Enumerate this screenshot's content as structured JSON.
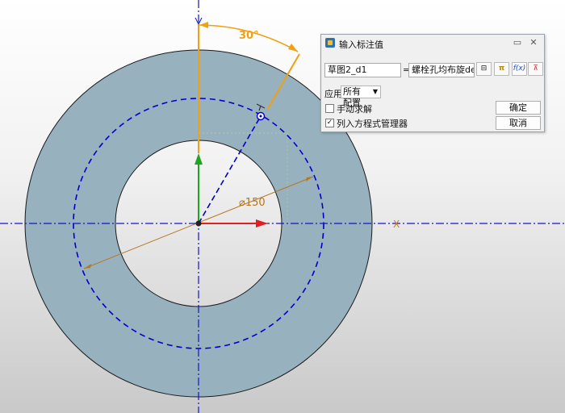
{
  "sketch": {
    "angle_dim_text": "30°",
    "diameter_dim_text": "⌀150",
    "x_axis_label": "X",
    "colors": {
      "ring_fill": "#97b1bf",
      "construction_circle": "#0000cc",
      "axis_line": "#1414c8",
      "dimension_orange": "#f0a010",
      "dimension_brown": "#b57620",
      "x_arrow": "#e02020",
      "y_arrow": "#1fa51f"
    }
  },
  "dialog": {
    "title": "输入标注值",
    "pin_icon": "pin-icon",
    "close_icon": "close-icon",
    "name_value": "草图2_d1",
    "equals": "=",
    "expression_value": "螺栓孔均布旋deg",
    "icon_buttons": [
      {
        "name": "measure-icon",
        "glyph": "⊟"
      },
      {
        "name": "pi-constant-icon",
        "glyph": "π"
      },
      {
        "name": "function-icon",
        "glyph": "f(x)"
      },
      {
        "name": "dimension-reference-icon",
        "glyph": "⊼"
      }
    ],
    "apply_label": "应用",
    "apply_select": "所有配置",
    "manual_solve_label": "手动求解",
    "manual_solve_checked": false,
    "equation_manager_label": "列入方程式管理器",
    "equation_manager_checked": true,
    "ok_label": "确定",
    "cancel_label": "取消"
  }
}
